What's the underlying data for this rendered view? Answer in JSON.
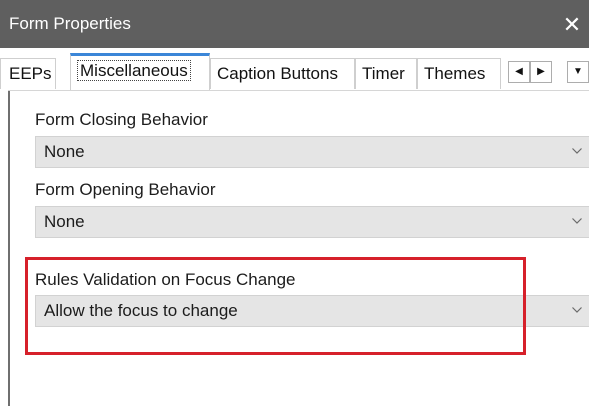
{
  "window": {
    "title": "Form Properties",
    "close_glyph": "✕"
  },
  "tabs": [
    {
      "label": "EEPs",
      "active": false
    },
    {
      "label": "Miscellaneous",
      "active": true
    },
    {
      "label": "Caption Buttons",
      "active": false
    },
    {
      "label": "Timer",
      "active": false
    },
    {
      "label": "Themes",
      "active": false
    }
  ],
  "tab_scroll": {
    "left_icon": "scroll-left-icon",
    "right_icon": "scroll-right-icon",
    "menu_icon": "overflow-menu-icon",
    "left_glyph": "◀",
    "right_glyph": "▶",
    "menu_glyph": "▼"
  },
  "fields": {
    "closing": {
      "label": "Form Closing Behavior",
      "value": "None"
    },
    "opening": {
      "label": "Form Opening Behavior",
      "value": "None"
    },
    "rules": {
      "label": "Rules Validation on Focus Change",
      "value": "Allow the focus to change"
    }
  },
  "colors": {
    "titlebar": "#5f5f5f",
    "active_tab_accent": "#3b86d8",
    "combo_fill": "#e5e5e5",
    "highlight": "#d6202a"
  }
}
